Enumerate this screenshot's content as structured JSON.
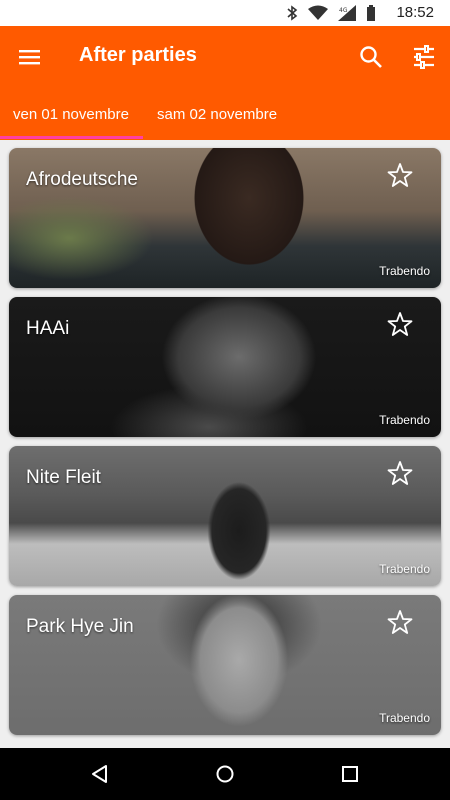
{
  "status_bar": {
    "time": "18:52",
    "icons": [
      "bluetooth-icon",
      "wifi-icon",
      "signal-4g-icon",
      "battery-icon"
    ]
  },
  "app_bar": {
    "title": "After parties",
    "color": "#ff5a00",
    "icons": [
      "menu-icon",
      "search-icon",
      "tune-icon"
    ]
  },
  "tabs": [
    {
      "label": "ven 01 novembre",
      "selected": true
    },
    {
      "label": "sam 02 novembre",
      "selected": false
    }
  ],
  "tab_indicator_color": "#ff3fa4",
  "events": [
    {
      "name": "Afrodeutsche",
      "venue": "Trabendo",
      "favorite": false
    },
    {
      "name": "HAAi",
      "venue": "Trabendo",
      "favorite": false
    },
    {
      "name": "Nite Fleit",
      "venue": "Trabendo",
      "favorite": false
    },
    {
      "name": "Park Hye Jin",
      "venue": "Trabendo",
      "favorite": false
    }
  ],
  "nav_bar": {
    "icons": [
      "back-icon",
      "home-icon",
      "recent-apps-icon"
    ]
  }
}
